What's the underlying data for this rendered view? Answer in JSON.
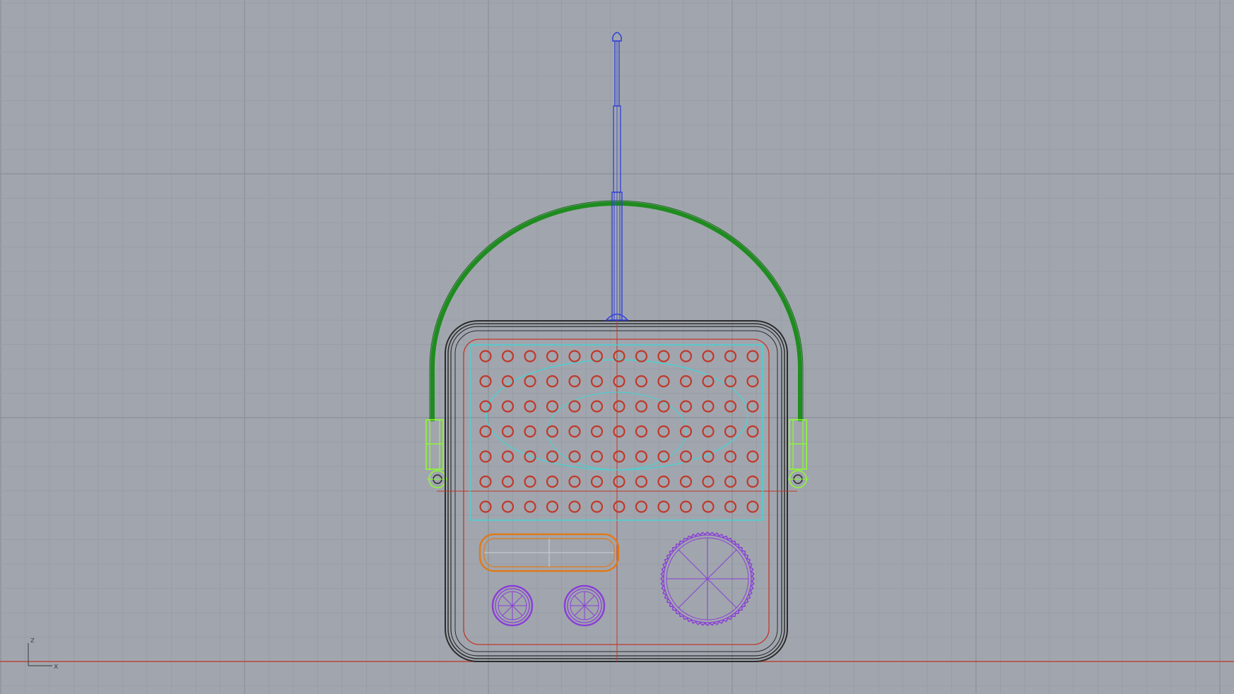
{
  "viewport": {
    "background": "#a1a6ae",
    "grid_minor_color": "#999ea6",
    "grid_major_color": "#8e939b",
    "x_axis_color": "#c0392b",
    "z_axis_color": "#c0392b"
  },
  "axis_widget": {
    "z_label": "z",
    "x_label": "x"
  },
  "model": {
    "name": "radio",
    "layers": {
      "antenna": "#2f3fd6",
      "handle": "#1e8c1e",
      "handle_brackets": "#8cff2a",
      "body": "#2b2b2b",
      "speaker_grille": "#c0392b",
      "speaker_outline": "#3fd6d6",
      "display_window": "#e07a1a",
      "knobs": "#8a3fd6"
    },
    "grille_rows": 7,
    "grille_cols": 13
  }
}
